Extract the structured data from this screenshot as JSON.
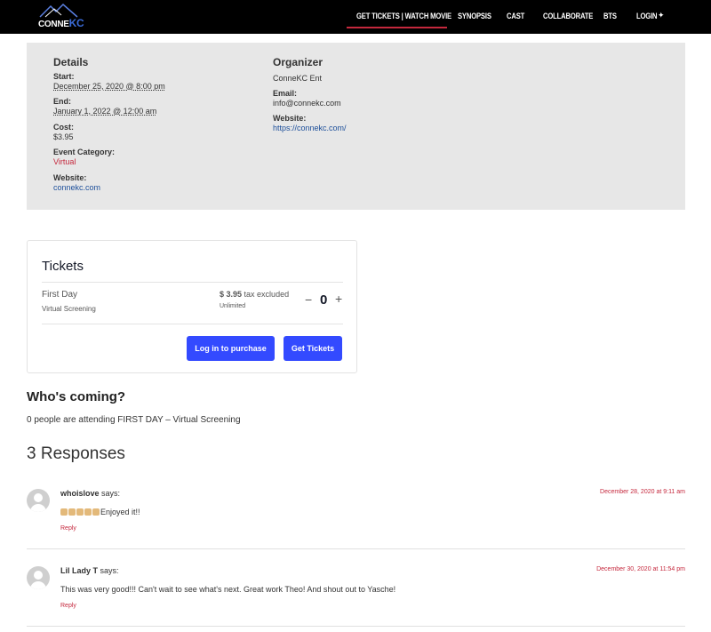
{
  "brand": {
    "logo_text_a": "CONNE",
    "logo_text_b": "KC",
    "accent": "#3a6bd8"
  },
  "nav": {
    "items": [
      "GET TICKETS | WATCH MOVIE",
      "SYNOPSIS",
      "CAST",
      "COLLABORATE",
      "BTS",
      "LOGIN"
    ],
    "login_icon": "plus-icon",
    "active_color": "#c5283d"
  },
  "details": {
    "heading": "Details",
    "start_label": "Start:",
    "start_value": "December 25, 2020 @ 8:00 pm",
    "end_label": "End:",
    "end_value": "January 1, 2022 @ 12:00 am",
    "cost_label": "Cost:",
    "cost_value": "$3.95",
    "category_label": "Event Category:",
    "category_value": "Virtual",
    "website_label": "Website:",
    "website_value": "connekc.com"
  },
  "organizer": {
    "heading": "Organizer",
    "name": "ConneKC Ent",
    "email_label": "Email:",
    "email_value": "info@connekc.com",
    "website_label": "Website:",
    "website_value": "https://connekc.com/"
  },
  "tickets": {
    "title": "Tickets",
    "name": "First Day",
    "description": "Virtual Screening",
    "price": "$ 3.95",
    "tax_note": "tax excluded",
    "availability": "Unlimited",
    "quantity": "0",
    "minus": "−",
    "plus": "+",
    "login_button": "Log in to purchase",
    "get_button": "Get Tickets",
    "button_color": "#334aff"
  },
  "attendees": {
    "heading": "Who's coming?",
    "text": "0 people are attending FIRST DAY – Virtual Screening"
  },
  "responses": {
    "heading": "3 Responses",
    "comments": [
      {
        "author": "whoislove",
        "says": "says:",
        "date": "December 28, 2020 at 9:11 am",
        "text": "Enjoyed it!!",
        "emoji_count": 5,
        "reply": "Reply"
      },
      {
        "author": "Lil Lady T",
        "says": "says:",
        "date": "December 30, 2020 at 11:54 pm",
        "text": "This was very good!!! Can't wait to see what's next. Great work Theo! And shout out to Yasche!",
        "emoji_count": 0,
        "reply": "Reply"
      }
    ]
  }
}
